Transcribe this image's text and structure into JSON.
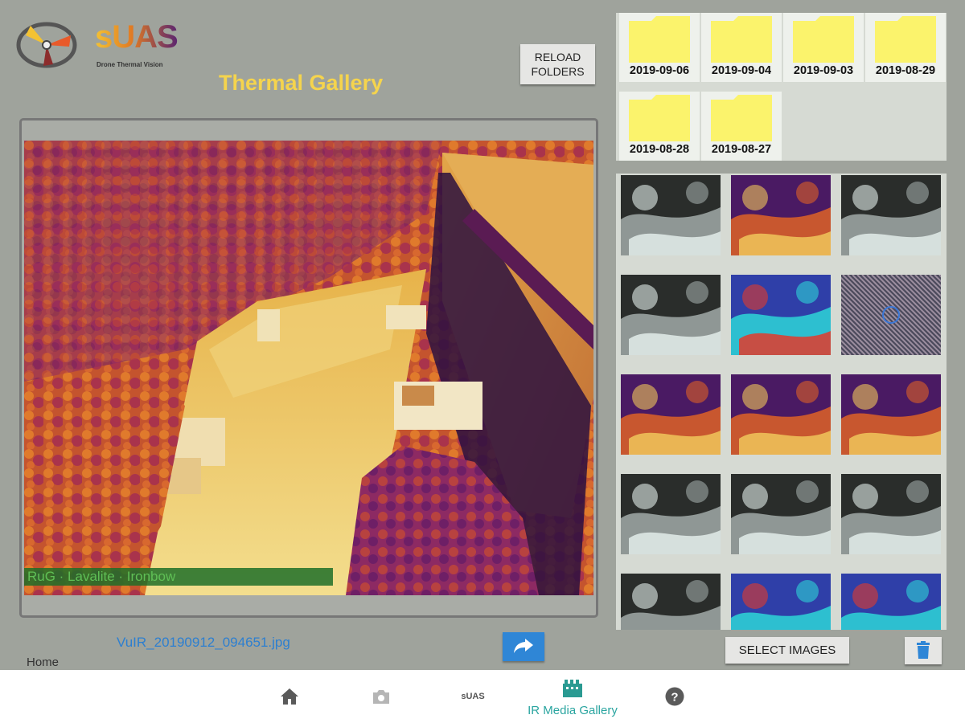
{
  "app": {
    "logo_text": "sUAS",
    "logo_subtitle": "Drone Thermal Vision",
    "title": "Thermal Gallery"
  },
  "toolbar": {
    "reload_label_line1": "RELOAD",
    "reload_label_line2": "FOLDERS"
  },
  "viewer": {
    "palette_bar_text": "RuG  ·  Lavalite  ·  Ironbow",
    "filename": "VuIR_20190912_094651.jpg"
  },
  "folders": [
    {
      "label": "2019-09-06"
    },
    {
      "label": "2019-09-04"
    },
    {
      "label": "2019-09-03"
    },
    {
      "label": "2019-08-29"
    },
    {
      "label": "2019-08-28"
    },
    {
      "label": "2019-08-27"
    }
  ],
  "thumbnails": [
    {
      "palette": "white-hot"
    },
    {
      "palette": "ironbow"
    },
    {
      "palette": "white-hot"
    },
    {
      "palette": "white-hot"
    },
    {
      "palette": "rainbow"
    },
    {
      "palette": "noise"
    },
    {
      "palette": "ironbow"
    },
    {
      "palette": "ironbow"
    },
    {
      "palette": "ironbow"
    },
    {
      "palette": "white-hot"
    },
    {
      "palette": "white-hot"
    },
    {
      "palette": "white-hot"
    },
    {
      "palette": "white-hot"
    },
    {
      "palette": "rainbow"
    },
    {
      "palette": "rainbow"
    }
  ],
  "actions": {
    "select_label": "SELECT IMAGES",
    "home_label": "Home"
  },
  "bottom_nav": {
    "items": [
      {
        "icon": "home-icon"
      },
      {
        "icon": "camera-icon"
      },
      {
        "icon": "suas-icon",
        "text": "sUAS"
      },
      {
        "icon": "film-icon",
        "label": "IR Media Gallery",
        "active": true
      },
      {
        "icon": "help-icon"
      }
    ]
  },
  "colors": {
    "background": "#9fa39c",
    "title": "#f5d44d",
    "folder": "#fbf36c",
    "accent": "#2aa5a0",
    "link": "#2d7fd0"
  }
}
